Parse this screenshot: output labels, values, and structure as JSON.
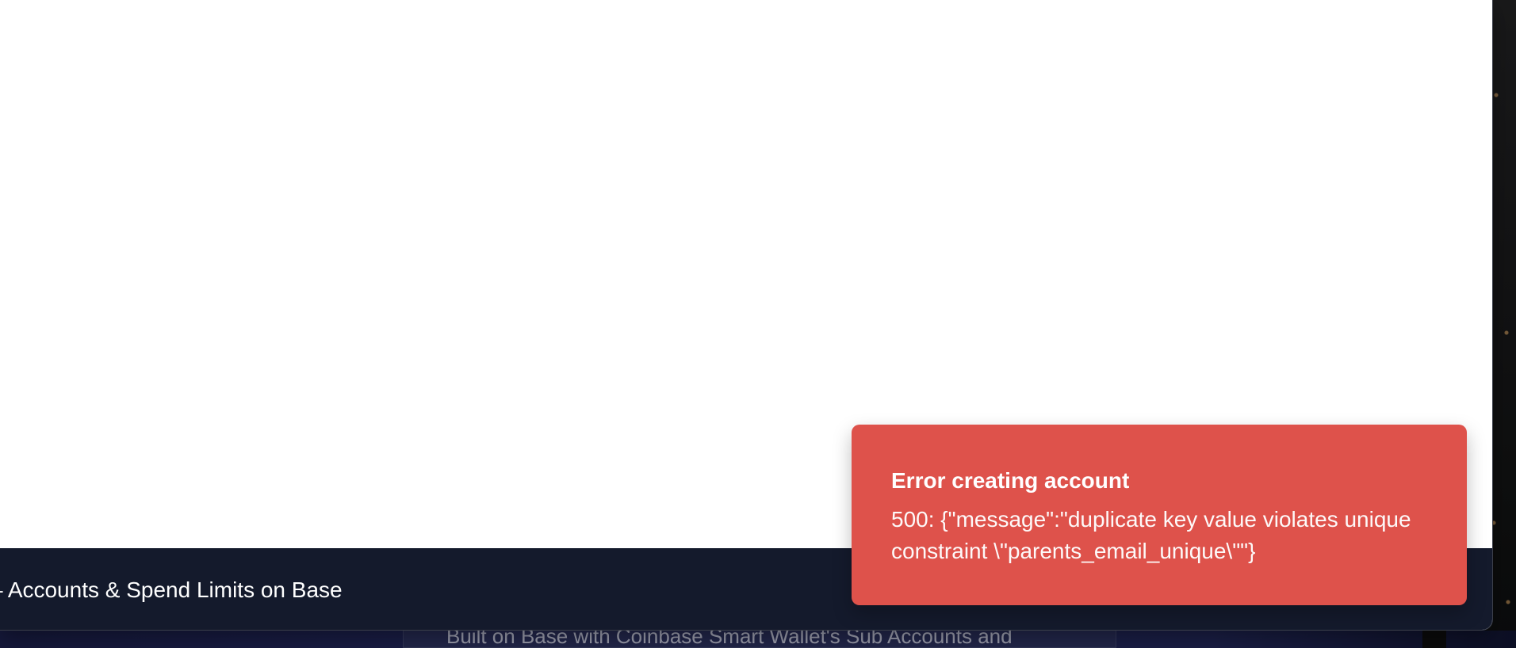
{
  "app": {
    "footer": {
      "text": "Accounts & Spend Limits on Base",
      "partial_prefix": "–"
    }
  },
  "toast": {
    "type": "error",
    "title": "Error creating account",
    "message": "500: {\"message\":\"duplicate key value violates unique constraint \\\"parents_email_unique\\\"\"}"
  },
  "background_page": {
    "partial_text": "Built on Base with Coinbase Smart Wallet's Sub Accounts and"
  },
  "colors": {
    "toast_bg": "#de524b",
    "footer_bg": "#141a2c",
    "content_bg": "#ffffff"
  }
}
